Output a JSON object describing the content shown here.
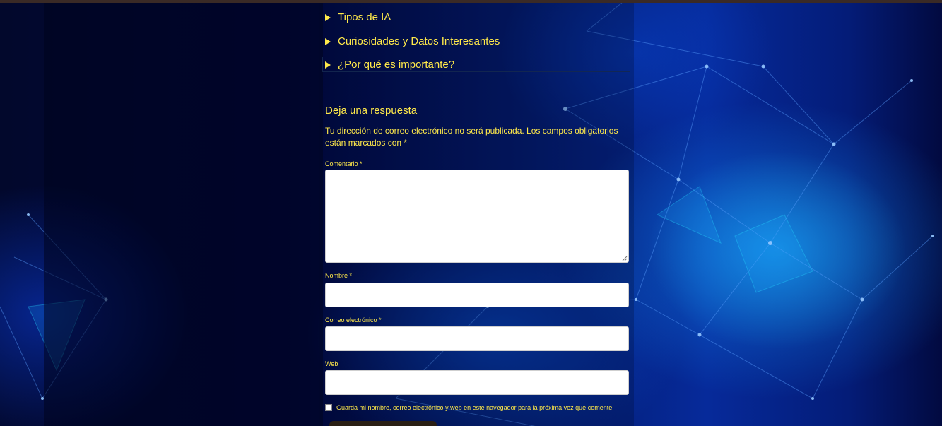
{
  "accordion": {
    "items": [
      {
        "label": "Tipos de IA"
      },
      {
        "label": "Curiosidades y Datos Interesantes"
      },
      {
        "label": "¿Por qué es importante?"
      }
    ]
  },
  "comment_form": {
    "title": "Deja una respuesta",
    "notice": "Tu dirección de correo electrónico no será publicada. Los campos obligatorios están marcados con *",
    "comment_label": "Comentario *",
    "name_label": "Nombre *",
    "email_label": "Correo electrónico *",
    "web_label": "Web",
    "save_consent_label": "Guarda mi nombre, correo electrónico y web en este navegador para la próxima vez que comente.",
    "comment_value": "",
    "name_value": "",
    "email_value": "",
    "web_value": "",
    "save_consent_checked": false
  },
  "colors": {
    "text_accent": "#ffe94a",
    "background": "#010a3a",
    "field_background": "#ffffff"
  }
}
